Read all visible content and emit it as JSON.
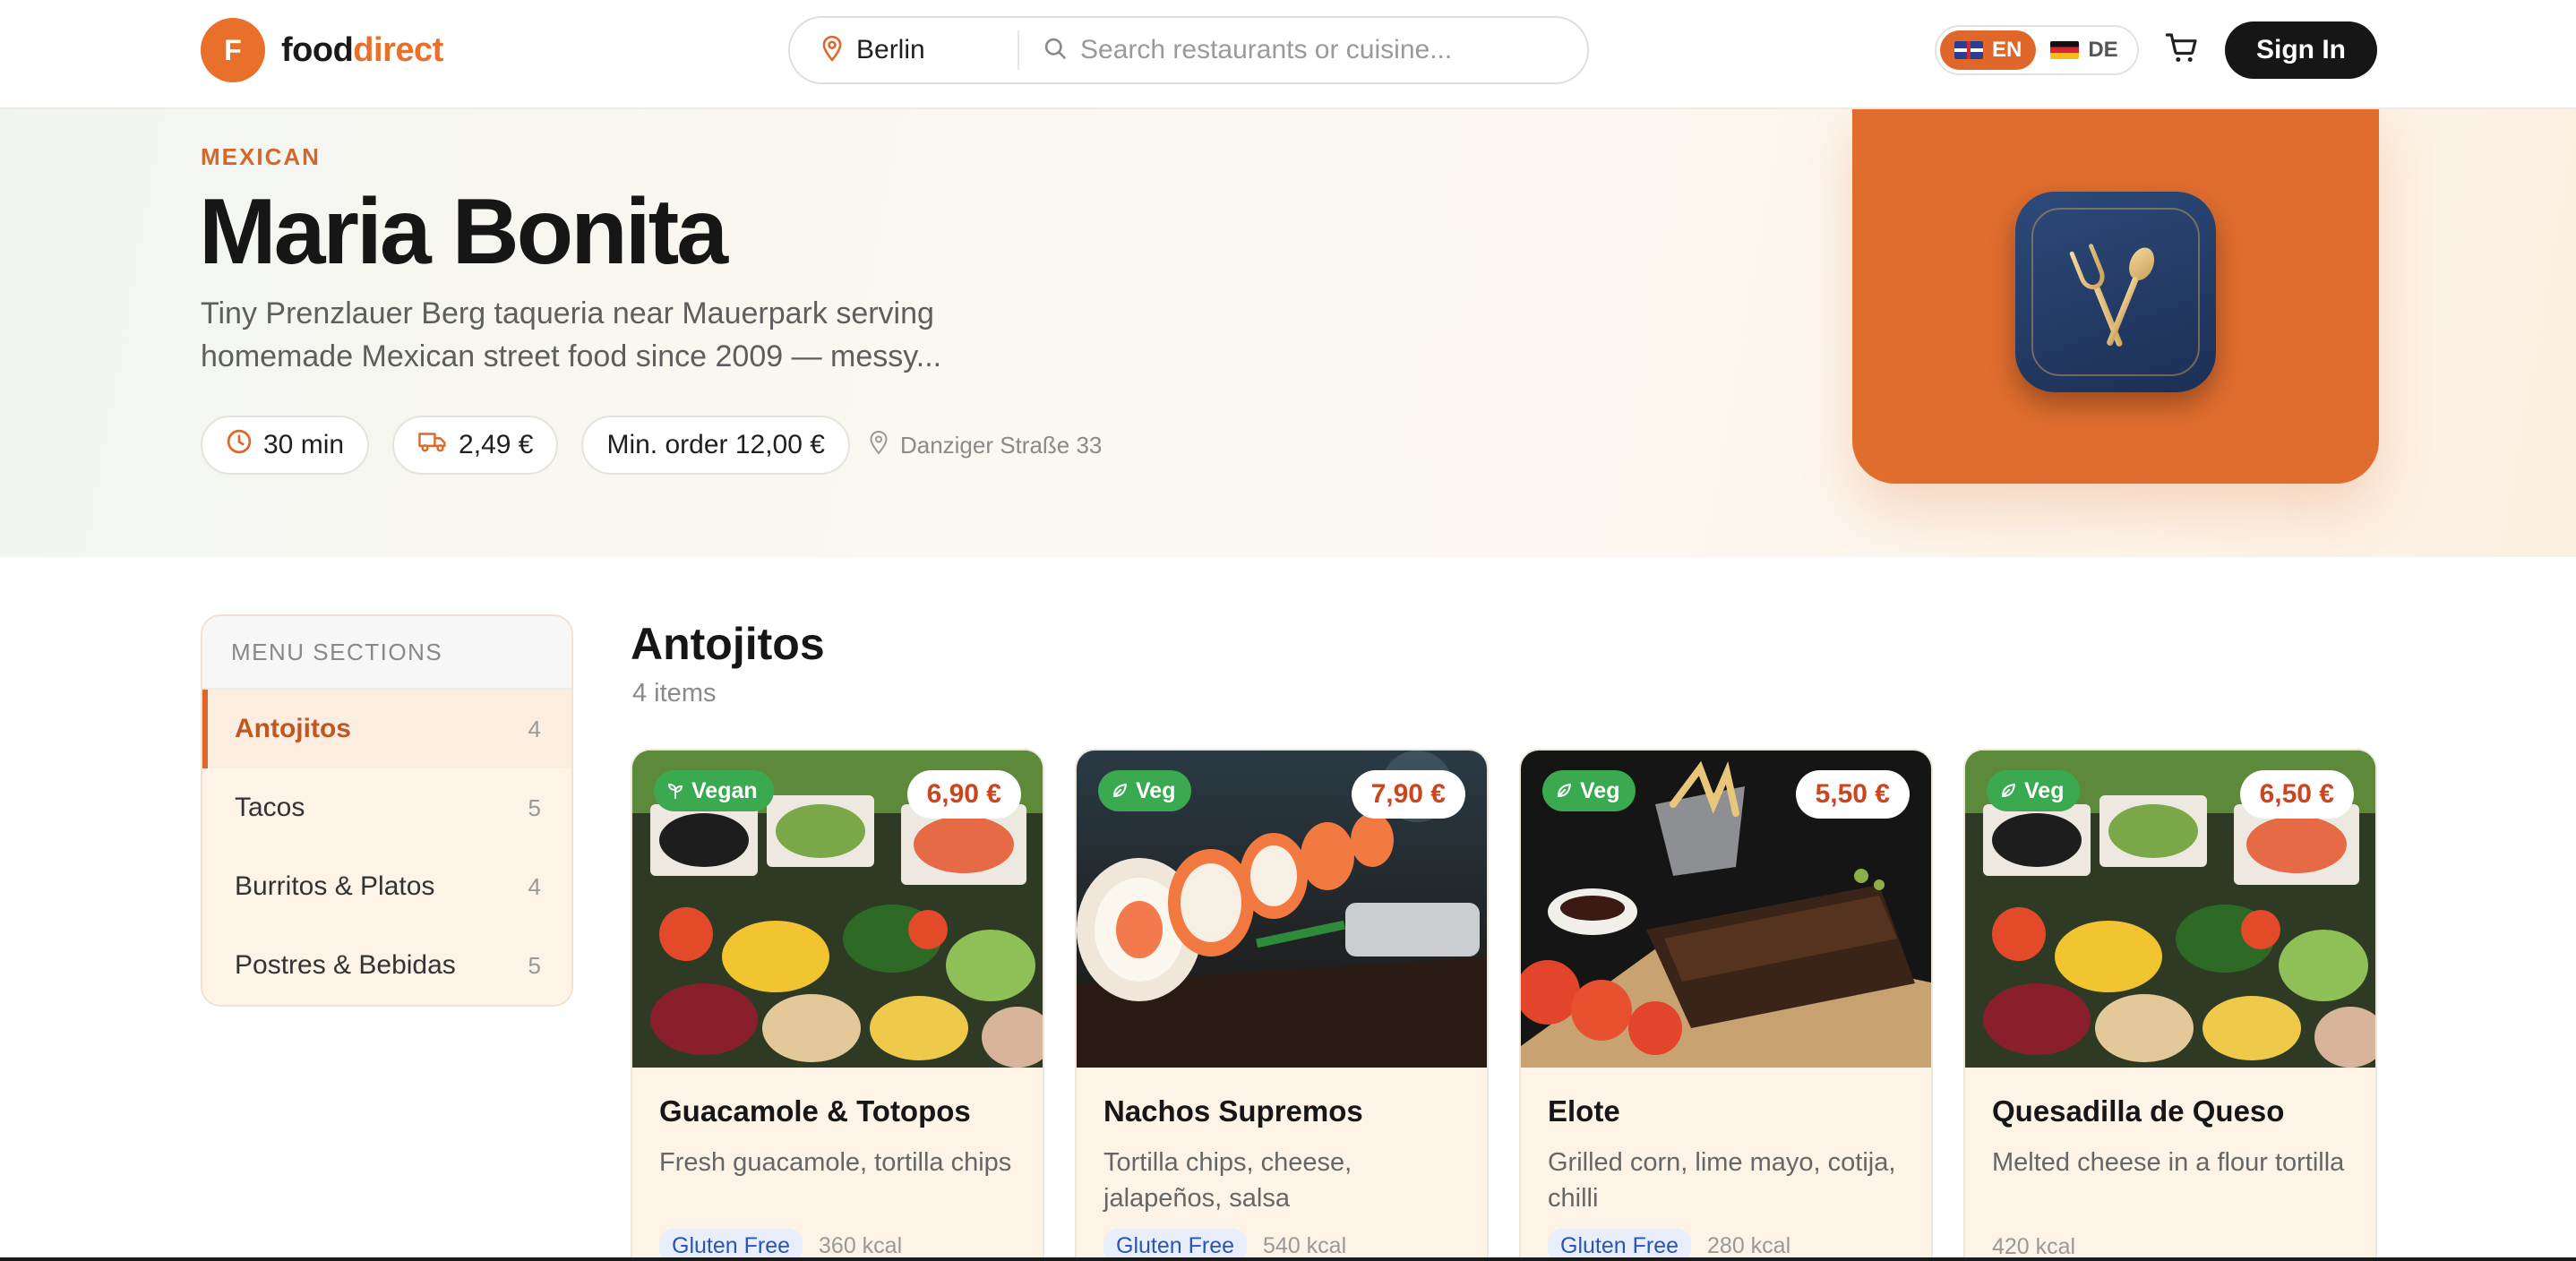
{
  "brand": {
    "badge": "F",
    "name_part1": "food",
    "name_part2": "direct",
    "accent": "#e8702a"
  },
  "search": {
    "city": "Berlin",
    "placeholder": "Search restaurants or cuisine..."
  },
  "language": {
    "options": [
      {
        "code": "EN",
        "flag": "flag-uk",
        "active": true
      },
      {
        "code": "DE",
        "flag": "flag-de",
        "active": false
      }
    ]
  },
  "header": {
    "cart_icon": "cart-icon",
    "signin_label": "Sign In"
  },
  "restaurant": {
    "cuisine": "MEXICAN",
    "name": "Maria Bonita",
    "description": "Tiny Prenzlauer Berg taqueria near Mauerpark serving homemade Mexican street food since 2009 — messy...",
    "delivery_time": "30 min",
    "delivery_fee": "2,49 €",
    "min_order": "Min. order 12,00 €",
    "address": "Danziger Straße 33"
  },
  "sidebar": {
    "heading": "MENU SECTIONS",
    "items": [
      {
        "label": "Antojitos",
        "count": "4",
        "active": true
      },
      {
        "label": "Tacos",
        "count": "5",
        "active": false
      },
      {
        "label": "Burritos & Platos",
        "count": "4",
        "active": false
      },
      {
        "label": "Postres & Bebidas",
        "count": "5",
        "active": false
      }
    ]
  },
  "section": {
    "title": "Antojitos",
    "subtitle": "4 items",
    "items": [
      {
        "badge": "Vegan",
        "badge_icon": "sprout-icon",
        "price": "6,90 €",
        "name": "Guacamole & Totopos",
        "description": "Fresh guacamole, tortilla chips",
        "tag": "Gluten Free",
        "kcal": "360 kcal",
        "image": "salad-bar-photo"
      },
      {
        "badge": "Veg",
        "badge_icon": "leaf-icon",
        "price": "7,90 €",
        "name": "Nachos Supremos",
        "description": "Tortilla chips, cheese, jalapeños, salsa",
        "tag": "Gluten Free",
        "kcal": "540 kcal",
        "image": "sushi-rolls-photo"
      },
      {
        "badge": "Veg",
        "badge_icon": "leaf-icon",
        "price": "5,50 €",
        "name": "Elote",
        "description": "Grilled corn, lime mayo, cotija, chilli",
        "tag": "Gluten Free",
        "kcal": "280 kcal",
        "image": "ribs-plate-photo"
      },
      {
        "badge": "Veg",
        "badge_icon": "leaf-icon",
        "price": "6,50 €",
        "name": "Quesadilla de Queso",
        "description": "Melted cheese in a flour tortilla",
        "tag": "",
        "kcal": "420 kcal",
        "image": "salad-bar-photo"
      }
    ]
  }
}
